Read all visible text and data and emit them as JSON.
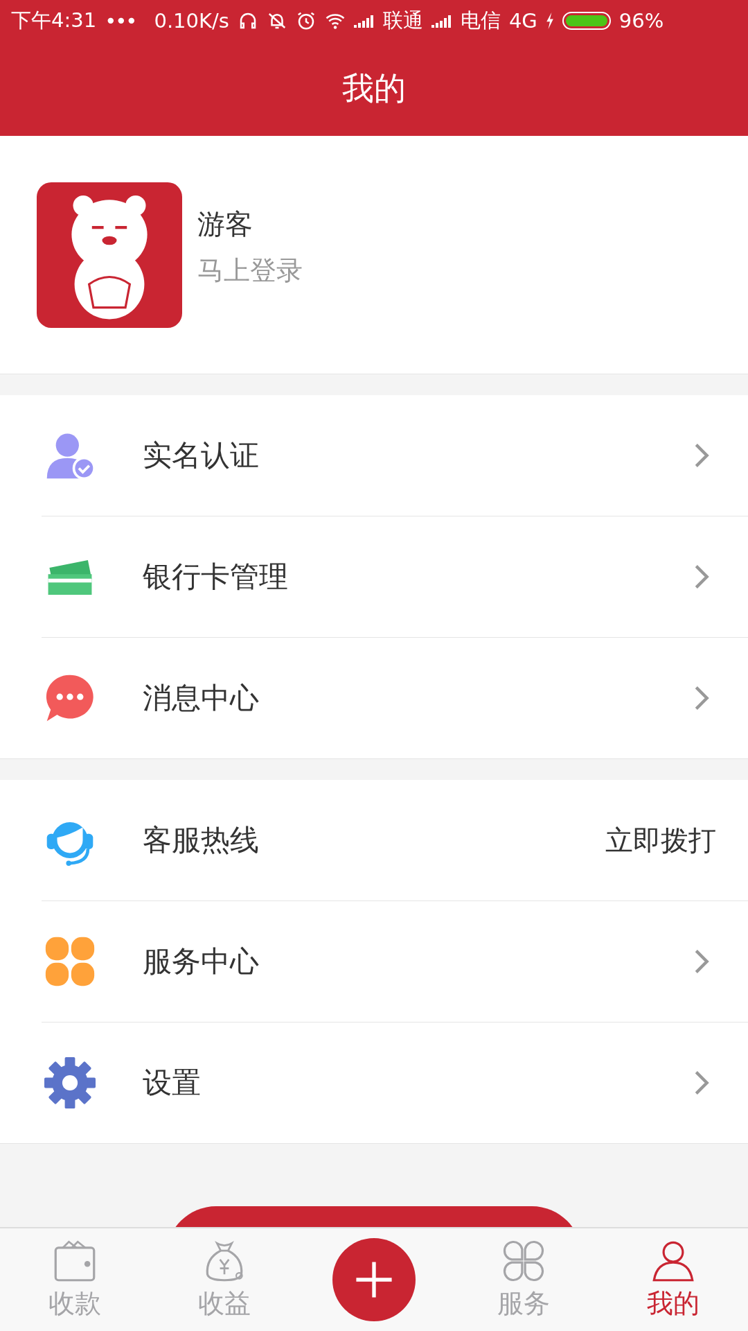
{
  "status_bar": {
    "time": "下午4:31",
    "dots": "•••",
    "speed": "0.10K/s",
    "carrier_1": "联通",
    "carrier_2": "电信",
    "network": "4G",
    "battery": "96%"
  },
  "header": {
    "title": "我的"
  },
  "profile": {
    "name": "游客",
    "subtitle": "马上登录"
  },
  "menu_groups": [
    [
      {
        "label": "实名认证",
        "kind": "chevron"
      },
      {
        "label": "银行卡管理",
        "kind": "chevron"
      },
      {
        "label": "消息中心",
        "kind": "chevron"
      }
    ],
    [
      {
        "label": "客服热线",
        "kind": "action",
        "action": "立即拨打"
      },
      {
        "label": "服务中心",
        "kind": "chevron"
      },
      {
        "label": "设置",
        "kind": "chevron"
      }
    ]
  ],
  "bottom_nav": [
    {
      "label": "收款",
      "kind": "tab",
      "selected": false
    },
    {
      "label": "收益",
      "kind": "tab",
      "selected": false
    },
    {
      "kind": "plus",
      "selected": false
    },
    {
      "label": "服务",
      "kind": "tab",
      "selected": false
    },
    {
      "label": "我的",
      "kind": "tab",
      "selected": true
    }
  ]
}
